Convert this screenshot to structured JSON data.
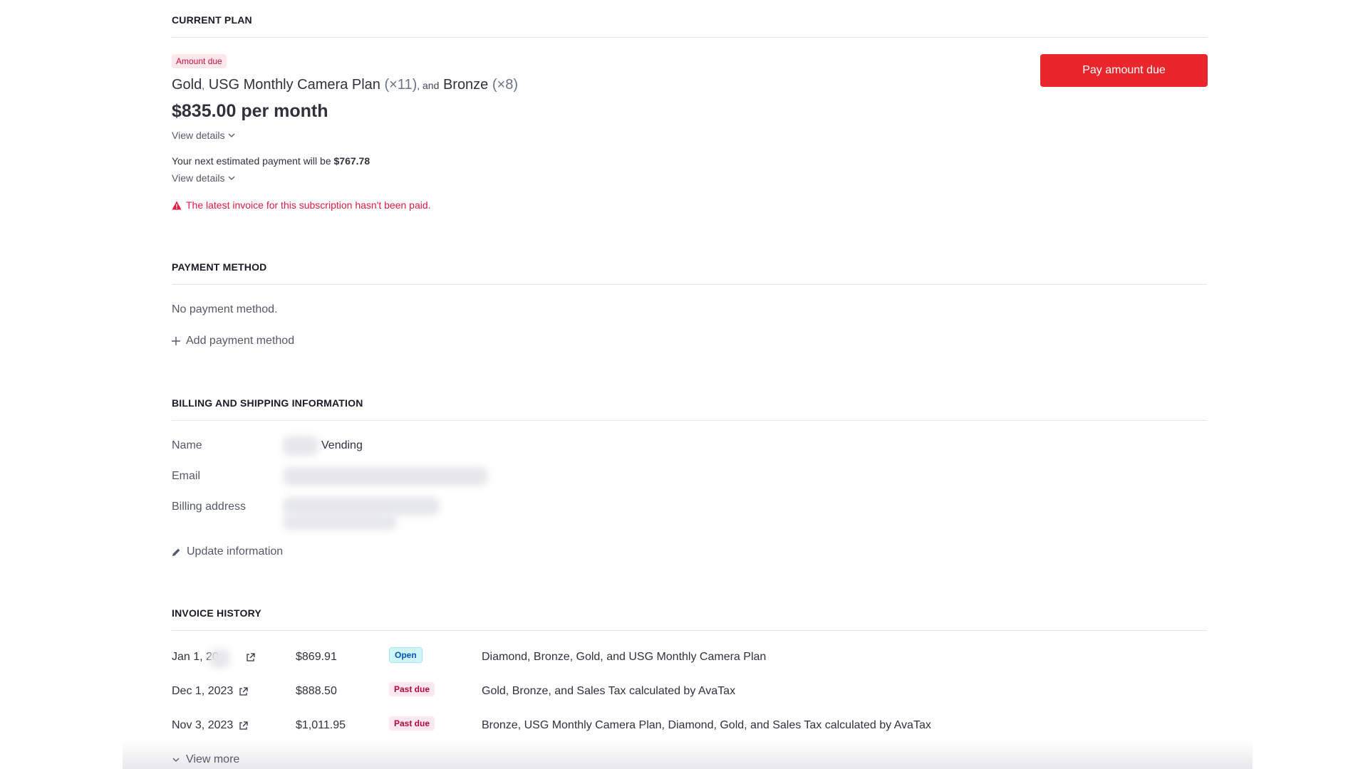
{
  "current_plan": {
    "section_title": "CURRENT PLAN",
    "badge": "Amount due",
    "plan_items": [
      {
        "name": "Gold",
        "sep": ",",
        "qty": ""
      },
      {
        "name": "USG Monthly Camera Plan",
        "sep": "",
        "qty": "(×11)"
      },
      {
        "name": "Bronze",
        "sep": ", and",
        "qty": "(×8)"
      }
    ],
    "price": "$835.00 per month",
    "view_details_1": "View details",
    "next_payment_prefix": "Your next estimated payment will be",
    "next_payment_amount": "$767.78",
    "view_details_2": "View details",
    "warning": "The latest invoice for this subscription hasn't been paid.",
    "pay_button": "Pay amount due"
  },
  "payment_method": {
    "section_title": "PAYMENT METHOD",
    "empty_text": "No payment method.",
    "add_label": "Add payment method"
  },
  "billing": {
    "section_title": "BILLING AND SHIPPING INFORMATION",
    "name_label": "Name",
    "name_value": "Vending",
    "email_label": "Email",
    "address_label": "Billing address",
    "update_label": "Update information"
  },
  "invoice_history": {
    "section_title": "INVOICE HISTORY",
    "rows": [
      {
        "date": "Jan 1, 20",
        "amount": "$869.91",
        "status": "Open",
        "description": "Diamond, Bronze, Gold, and USG Monthly Camera Plan"
      },
      {
        "date": "Dec 1, 2023",
        "amount": "$888.50",
        "status": "Past due",
        "description": "Gold, Bronze, and Sales Tax calculated by AvaTax"
      },
      {
        "date": "Nov 3, 2023",
        "amount": "$1,011.95",
        "status": "Past due",
        "description": "Bronze, USG Monthly Camera Plan, Diamond, Gold, and Sales Tax calculated by AvaTax"
      }
    ],
    "view_more": "View more"
  },
  "colors": {
    "accent_red": "#e8262b",
    "warning_red": "#df1b41",
    "open_badge": "#cff5f6",
    "past_due_badge": "#ffe7f2"
  }
}
